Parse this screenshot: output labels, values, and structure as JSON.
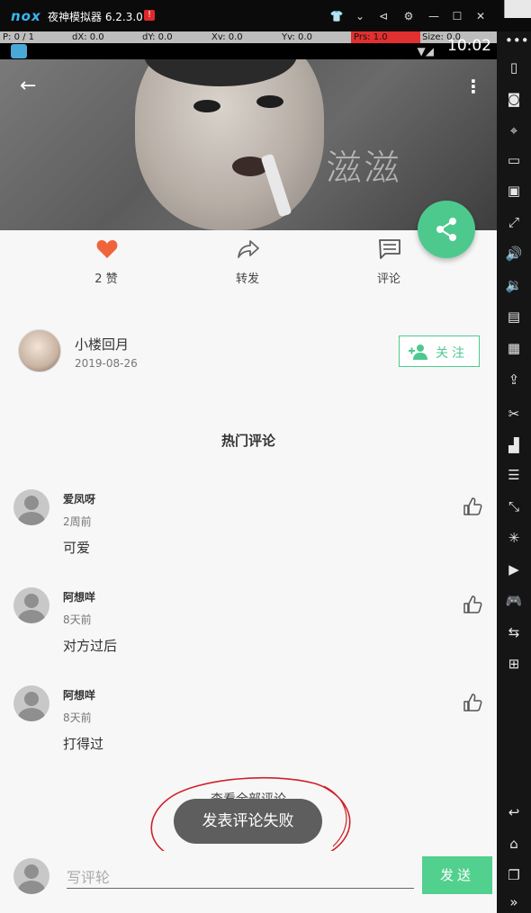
{
  "emulator": {
    "logo": "nox",
    "title": "夜神模拟器 6.2.3.0",
    "warning": "!"
  },
  "debug": {
    "p": "P: 0 / 1",
    "dx": "dX: 0.0",
    "dy": "dY: 0.0",
    "xv": "Xv: 0.0",
    "yv": "Yv: 0.0",
    "prs": "Prs: 1.0",
    "size": "Size: 0.0"
  },
  "status": {
    "time": "10:02"
  },
  "post": {
    "cover_text": "滋滋",
    "actions": [
      {
        "label": "2 赞",
        "icon": "heart-icon",
        "color": "#f0643c"
      },
      {
        "label": "转发",
        "icon": "share-arrow-icon",
        "color": "#666666"
      },
      {
        "label": "评论",
        "icon": "comment-icon",
        "color": "#666666"
      }
    ],
    "author": {
      "name": "小楼回月",
      "date": "2019-08-26"
    },
    "follow_label": "关注"
  },
  "comments_section": {
    "title": "热门评论",
    "comments": [
      {
        "name": "爱凤呀",
        "time": "2周前",
        "text": "可爱"
      },
      {
        "name": "阿想咩",
        "time": "8天前",
        "text": "对方过后"
      },
      {
        "name": "阿想咩",
        "time": "8天前",
        "text": "打得过"
      }
    ],
    "view_all": "查看全部评论"
  },
  "toast": "发表评论失败",
  "input": {
    "placeholder": "写评轮",
    "send_label": "发送"
  },
  "colors": {
    "accent": "#4ec98e",
    "toast_bg": "#5e5e5e",
    "annotation": "#d0202a"
  }
}
